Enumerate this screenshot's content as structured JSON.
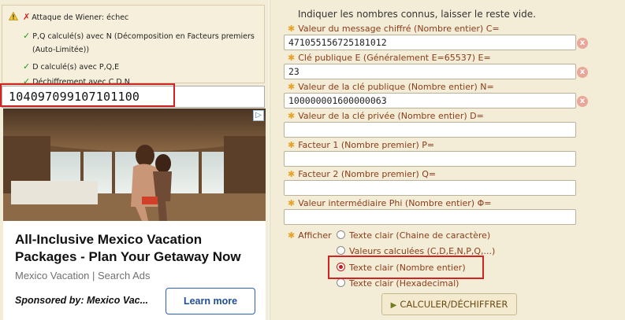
{
  "log": {
    "lines": [
      {
        "status": "fail",
        "text": "Attaque de Wiener: échec"
      },
      {
        "status": "ok",
        "text": "P,Q calculé(s) avec N (Décomposition en Facteurs premiers"
      },
      {
        "status": "none",
        "text": "(Auto-Limitée))"
      },
      {
        "status": "ok",
        "text": "D calculé(s) avec P,Q,E"
      },
      {
        "status": "ok",
        "text": "Déchiffrement avec C,D,N"
      }
    ]
  },
  "result": {
    "value": "104097099107101100"
  },
  "ad": {
    "title": "All-Inclusive Mexico Vacation Packages - Plan Your Getaway Now",
    "source": "Mexico Vacation | Search Ads",
    "sponsor": "Sponsored by: Mexico Vac...",
    "button": "Learn more"
  },
  "form": {
    "intro": "Indiquer les nombres connus, laisser le reste vide.",
    "fields": [
      {
        "label": "Valeur du message chiffré (Nombre entier) C=",
        "value": "471055156725181012"
      },
      {
        "label": "Clé publique E (Généralement E=65537) E=",
        "value": "23"
      },
      {
        "label": "Valeur de la clé publique (Nombre entier) N=",
        "value": "100000001600000063"
      },
      {
        "label": "Valeur de la clé privée (Nombre entier) D=",
        "value": ""
      },
      {
        "label": "Facteur 1 (Nombre premier) P=",
        "value": ""
      },
      {
        "label": "Facteur 2 (Nombre premier) Q=",
        "value": ""
      },
      {
        "label": "Valeur intermédiaire Phi (Nombre entier) Φ=",
        "value": ""
      }
    ],
    "clear_symbol": "x",
    "afficher_label": "Afficher",
    "options": [
      {
        "label": "Texte clair (Chaine de caractère)",
        "selected": false
      },
      {
        "label": "Valeurs calculées (C,D,E,N,P,Q,...)",
        "selected": false
      },
      {
        "label": "Texte clair (Nombre entier)",
        "selected": true
      },
      {
        "label": "Texte clair (Hexadecimal)",
        "selected": false
      }
    ],
    "submit": "CALCULER/DÉCHIFFRER"
  },
  "colors": {
    "panel_bg": "#f3ecd6",
    "label": "#8b3d1a",
    "highlight": "#d32222",
    "accent_star": "#e8a227"
  }
}
